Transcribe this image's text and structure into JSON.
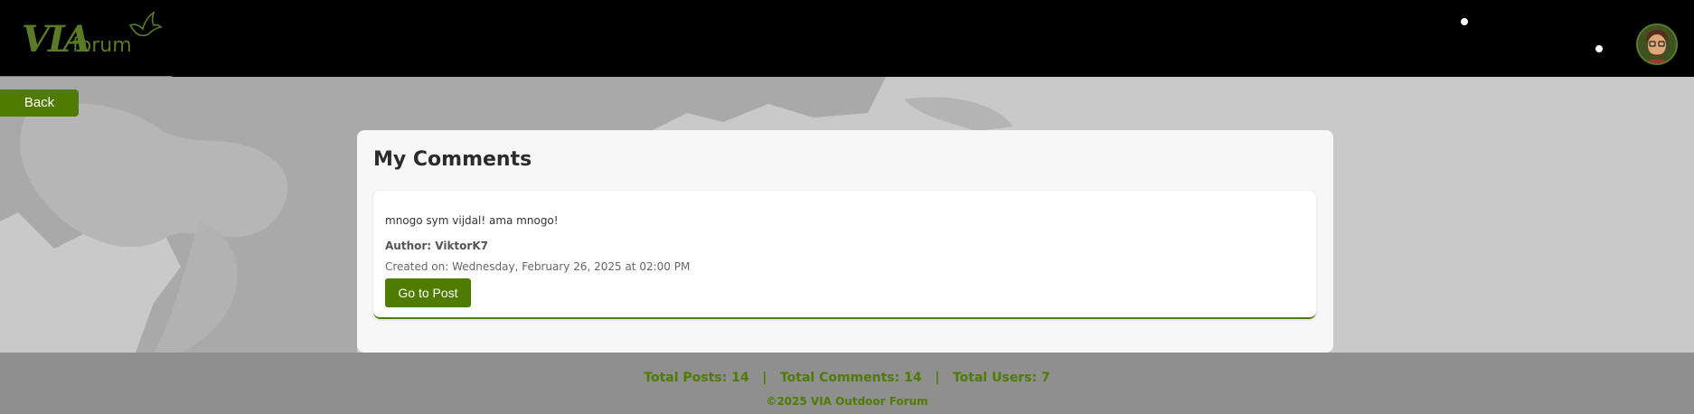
{
  "header": {
    "logo_text": "VIA",
    "logo_sub": "forum"
  },
  "nav": {
    "back_label": "Back"
  },
  "main": {
    "title": "My Comments",
    "comments": [
      {
        "text": "mnogo sym vijdal! ama mnogo!",
        "author": "Author: ViktorK7",
        "created": "Created on: Wednesday, February 26, 2025 at 02:00 PM",
        "button_label": "Go to Post"
      }
    ]
  },
  "footer": {
    "stats": "Total Posts: 14   |   Total Comments: 14   |   Total Users: 7",
    "copyright": "©2025 VIA Outdoor Forum"
  },
  "colors": {
    "accent": "#4f7b00",
    "header_bg": "#000000",
    "footer_bg": "#8f8f8f"
  }
}
